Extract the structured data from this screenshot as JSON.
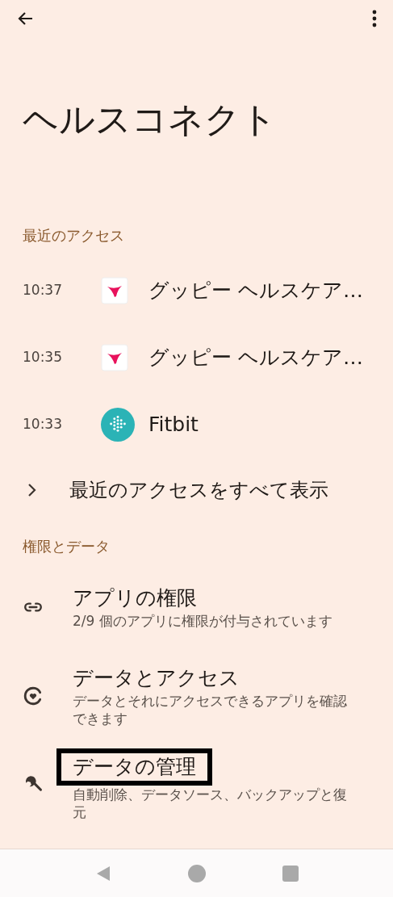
{
  "title": "ヘルスコネクト",
  "recent": {
    "header": "最近のアクセス",
    "items": [
      {
        "time": "10:37",
        "app": "グッピー ヘルスケア…",
        "kind": "mark"
      },
      {
        "time": "10:35",
        "app": "グッピー ヘルスケア…",
        "kind": "mark"
      },
      {
        "time": "10:33",
        "app": "Fitbit",
        "kind": "dots"
      }
    ],
    "view_all": "最近のアクセスをすべて表示"
  },
  "permissions": {
    "header": "権限とデータ",
    "items": [
      {
        "kind": "link",
        "title": "アプリの権限",
        "subtitle": "2/9 個のアプリに権限が付与されています",
        "highlighted": false
      },
      {
        "kind": "heart",
        "title": "データとアクセス",
        "subtitle": "データとそれにアクセスできるアプリを確認できます",
        "highlighted": false
      },
      {
        "kind": "wrench",
        "title": "データの管理",
        "subtitle": "自動削除、データソース、バックアップと復元",
        "highlighted": true
      }
    ]
  }
}
